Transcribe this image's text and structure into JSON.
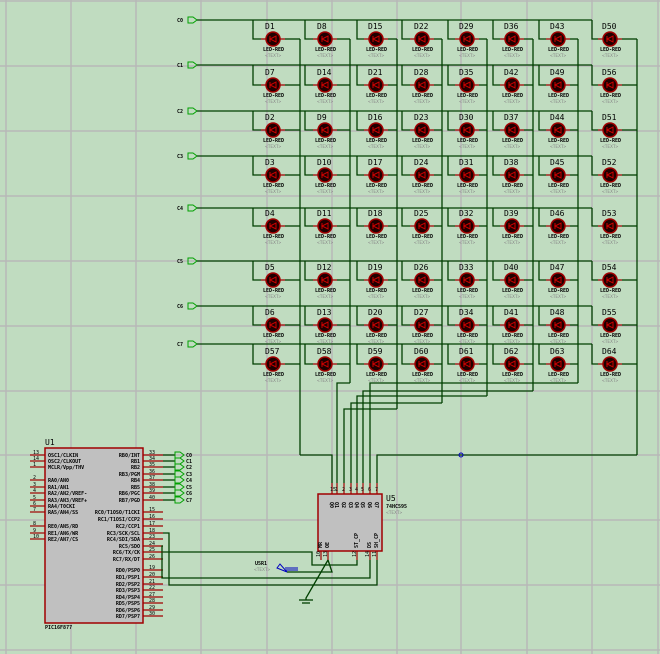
{
  "colors": {
    "background": "#c0dcc0",
    "wire": "#004000",
    "grid": "#b8b8b8",
    "pin": "#a00000",
    "chip_fill": "#c0c0c0",
    "led_body": "#200000",
    "terminal": "#00a000",
    "probe": "#0000c0"
  },
  "row_terminals": [
    "C0",
    "C1",
    "C2",
    "C3",
    "C4",
    "C5",
    "C6",
    "C7"
  ],
  "led_grid": [
    [
      "D1",
      "D8",
      "D15",
      "D22",
      "D29",
      "D36",
      "D43",
      "D50"
    ],
    [
      "D7",
      "D14",
      "D21",
      "D28",
      "D35",
      "D42",
      "D49",
      "D56"
    ],
    [
      "D2",
      "D9",
      "D16",
      "D23",
      "D30",
      "D37",
      "D44",
      "D51"
    ],
    [
      "D3",
      "D10",
      "D17",
      "D24",
      "D31",
      "D38",
      "D45",
      "D52"
    ],
    [
      "D4",
      "D11",
      "D18",
      "D25",
      "D32",
      "D39",
      "D46",
      "D53"
    ],
    [
      "D5",
      "D12",
      "D19",
      "D26",
      "D33",
      "D40",
      "D47",
      "D54"
    ],
    [
      "D6",
      "D13",
      "D20",
      "D27",
      "D34",
      "D41",
      "D48",
      "D55"
    ],
    [
      "D57",
      "D58",
      "D59",
      "D60",
      "D61",
      "D62",
      "D63",
      "D64"
    ]
  ],
  "led_value": "LED-RED",
  "text_placeholder": "<TEXT>",
  "u1": {
    "ref": "U1",
    "part": "PIC16F877",
    "left_pins": [
      {
        "num": "13",
        "name": "OSC1/CLKIN"
      },
      {
        "num": "14",
        "name": "OSC2/CLKOUT"
      },
      {
        "num": "1",
        "name": "MCLR/Vpp/THV"
      },
      {
        "num": "2",
        "name": "RA0/AN0"
      },
      {
        "num": "3",
        "name": "RA1/AN1"
      },
      {
        "num": "4",
        "name": "RA2/AN2/VREF-"
      },
      {
        "num": "5",
        "name": "RA3/AN3/VREF+"
      },
      {
        "num": "6",
        "name": "RA4/T0CKI"
      },
      {
        "num": "7",
        "name": "RA5/AN4/SS"
      },
      {
        "num": "8",
        "name": "RE0/AN5/RD"
      },
      {
        "num": "9",
        "name": "RE1/AN6/WR"
      },
      {
        "num": "10",
        "name": "RE2/AN7/CS"
      }
    ],
    "right_pins": [
      {
        "num": "33",
        "name": "RB0/INT"
      },
      {
        "num": "34",
        "name": "RB1"
      },
      {
        "num": "35",
        "name": "RB2"
      },
      {
        "num": "36",
        "name": "RB3/PGM"
      },
      {
        "num": "37",
        "name": "RB4"
      },
      {
        "num": "38",
        "name": "RB5"
      },
      {
        "num": "39",
        "name": "RB6/PGC"
      },
      {
        "num": "40",
        "name": "RB7/PGD"
      },
      {
        "num": "15",
        "name": "RC0/T1OSO/T1CKI"
      },
      {
        "num": "16",
        "name": "RC1/T1OSI/CCP2"
      },
      {
        "num": "17",
        "name": "RC2/CCP1"
      },
      {
        "num": "18",
        "name": "RC3/SCK/SCL"
      },
      {
        "num": "23",
        "name": "RC4/SDI/SDA"
      },
      {
        "num": "24",
        "name": "RC5/SDO"
      },
      {
        "num": "25",
        "name": "RC6/TX/CK"
      },
      {
        "num": "26",
        "name": "RC7/RX/DT"
      },
      {
        "num": "19",
        "name": "RD0/PSP0"
      },
      {
        "num": "20",
        "name": "RD1/PSP1"
      },
      {
        "num": "21",
        "name": "RD2/PSP2"
      },
      {
        "num": "22",
        "name": "RD3/PSP3"
      },
      {
        "num": "27",
        "name": "RD4/PSP4"
      },
      {
        "num": "28",
        "name": "RD5/PSP5"
      },
      {
        "num": "29",
        "name": "RD6/PSP6"
      },
      {
        "num": "30",
        "name": "RD7/PSP7"
      }
    ],
    "rb_terminals": [
      "C0",
      "C1",
      "C2",
      "C3",
      "C4",
      "C5",
      "C6",
      "C7"
    ]
  },
  "u5": {
    "ref": "U5",
    "part": "74HC595",
    "top_pins": [
      {
        "num": "15",
        "name": "Q0"
      },
      {
        "num": "1",
        "name": "Q1"
      },
      {
        "num": "2",
        "name": "Q2"
      },
      {
        "num": "3",
        "name": "Q3"
      },
      {
        "num": "4",
        "name": "Q4"
      },
      {
        "num": "5",
        "name": "Q5"
      },
      {
        "num": "6",
        "name": "Q6"
      },
      {
        "num": "7",
        "name": "Q7"
      }
    ],
    "bottom_pins": [
      {
        "num": "10",
        "name": "MR"
      },
      {
        "num": "13",
        "name": "OE"
      },
      {
        "num": "12",
        "name": "ST_CP"
      },
      {
        "num": "14",
        "name": "DS"
      },
      {
        "num": "11",
        "name": "SH_CP"
      }
    ]
  },
  "probe_label": "U5R1"
}
